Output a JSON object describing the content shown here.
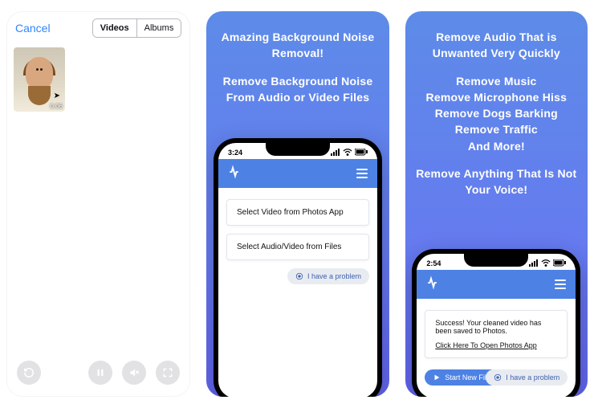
{
  "panel1": {
    "cancel": "Cancel",
    "tabs": {
      "videos": "Videos",
      "albums": "Albums"
    },
    "thumb": {
      "duration": "0:06"
    }
  },
  "panel2": {
    "headline_a": "Amazing Background Noise Removal!",
    "headline_b": "Remove Background Noise From Audio or Video Files",
    "phone": {
      "time": "3:24",
      "option1": "Select Video from Photos App",
      "option2": "Select Audio/Video from Files",
      "help_chip": "I have a problem"
    }
  },
  "panel3": {
    "lines": [
      "Remove Audio That is Unwanted Very Quickly",
      "Remove Music\nRemove Microphone Hiss\nRemove Dogs Barking\nRemove Traffic\nAnd More!",
      "Remove Anything That Is Not Your Voice!"
    ],
    "phone": {
      "time": "2:54",
      "success": "Success! Your cleaned video has been saved to Photos.",
      "open_link": "Click Here To Open Photos App",
      "start_btn": "Start New File",
      "help_chip": "I have a problem"
    }
  }
}
